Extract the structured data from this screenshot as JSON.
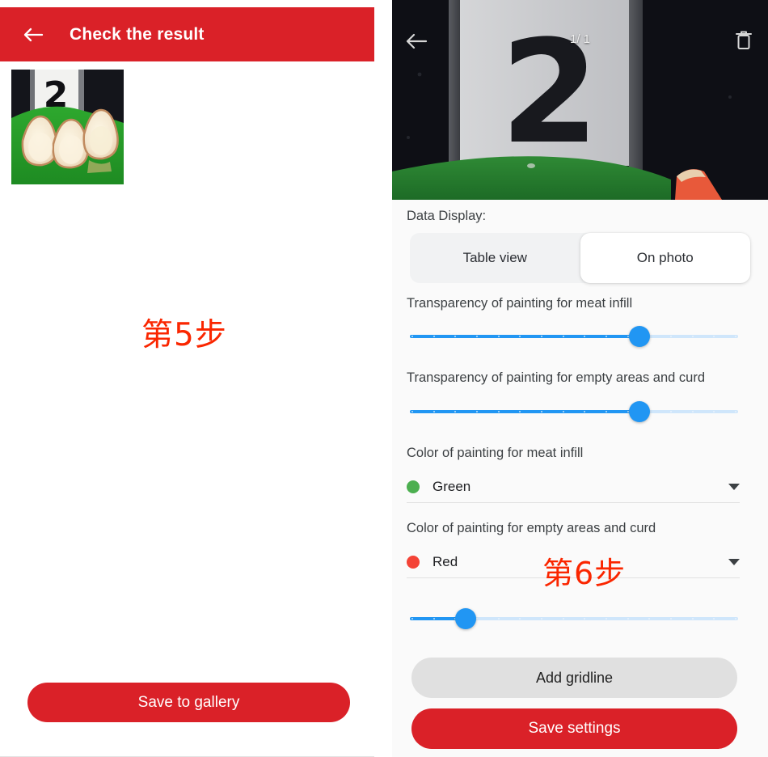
{
  "theme": {
    "brand_red": "#da2128",
    "accent_blue": "#2196f3",
    "annotation_red": "#fa2600",
    "panel_background": "#fafafa"
  },
  "left_screen": {
    "appbar": {
      "back_icon": "arrow-left-icon",
      "title": "Check the result"
    },
    "thumbnail": {
      "alt": "photo thumbnail of three halved bulbs on a green board with label card 2",
      "label_card_text": "2"
    },
    "annotation": "第5步",
    "primary_button": "Save to gallery"
  },
  "right_screen": {
    "photo_viewer": {
      "back_icon": "arrow-left-icon",
      "counter": "1/ 1",
      "delete_icon": "trash-icon",
      "label_card_text": "2"
    },
    "data_display": {
      "label": "Data Display:",
      "options": [
        "Table view",
        "On photo"
      ],
      "selected": "On photo"
    },
    "sliders": [
      {
        "label": "Transparency of painting for meat infill",
        "value_percent": 70,
        "tick_count": 16
      },
      {
        "label": "Transparency of painting for empty areas and curd",
        "value_percent": 70,
        "tick_count": 16
      },
      {
        "label": "",
        "value_percent": 17,
        "tick_count": 16
      }
    ],
    "color_pickers": [
      {
        "label": "Color of painting for meat infill",
        "value": "Green",
        "swatch": "#4caf50",
        "caret_icon": "chevron-down-icon"
      },
      {
        "label": "Color of painting for empty areas and curd",
        "value": "Red",
        "swatch": "#f44336",
        "caret_icon": "chevron-down-icon"
      }
    ],
    "annotation": "第6步",
    "secondary_button": "Add gridline",
    "primary_button": "Save settings"
  }
}
